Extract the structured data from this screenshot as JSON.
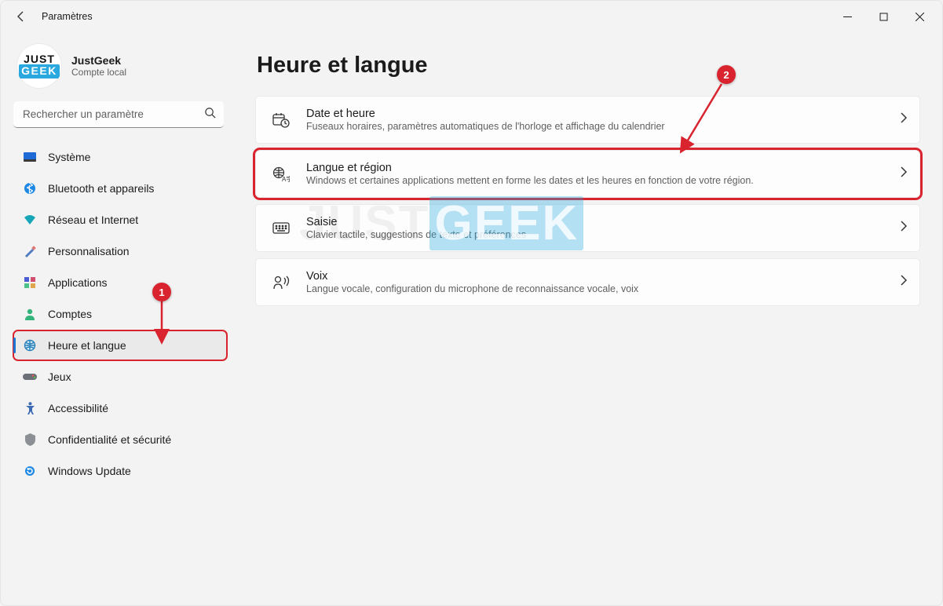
{
  "window": {
    "title": "Paramètres"
  },
  "profile": {
    "avatar_line1": "JUST",
    "avatar_line2": "GEEK",
    "name": "JustGeek",
    "account_type": "Compte local"
  },
  "search": {
    "placeholder": "Rechercher un paramètre"
  },
  "sidebar": {
    "items": [
      {
        "label": "Système"
      },
      {
        "label": "Bluetooth et appareils"
      },
      {
        "label": "Réseau et Internet"
      },
      {
        "label": "Personnalisation"
      },
      {
        "label": "Applications"
      },
      {
        "label": "Comptes"
      },
      {
        "label": "Heure et langue"
      },
      {
        "label": "Jeux"
      },
      {
        "label": "Accessibilité"
      },
      {
        "label": "Confidentialité et sécurité"
      },
      {
        "label": "Windows Update"
      }
    ],
    "active_index": 6
  },
  "page": {
    "title": "Heure et langue"
  },
  "cards": [
    {
      "title": "Date et heure",
      "desc": "Fuseaux horaires, paramètres automatiques de l'horloge et affichage du calendrier"
    },
    {
      "title": "Langue et région",
      "desc": "Windows et certaines applications mettent en forme les dates et les heures en fonction de votre région."
    },
    {
      "title": "Saisie",
      "desc": "Clavier tactile, suggestions de texte et préférences"
    },
    {
      "title": "Voix",
      "desc": "Langue vocale, configuration du microphone de reconnaissance vocale, voix"
    }
  ],
  "annotations": {
    "callout1": "1",
    "callout2": "2"
  },
  "watermark": {
    "part1": "JUST",
    "part2": "GEEK"
  },
  "colors": {
    "accent": "#1976d2",
    "annotation": "#d9232e",
    "brand_blue": "#29a8e0"
  }
}
